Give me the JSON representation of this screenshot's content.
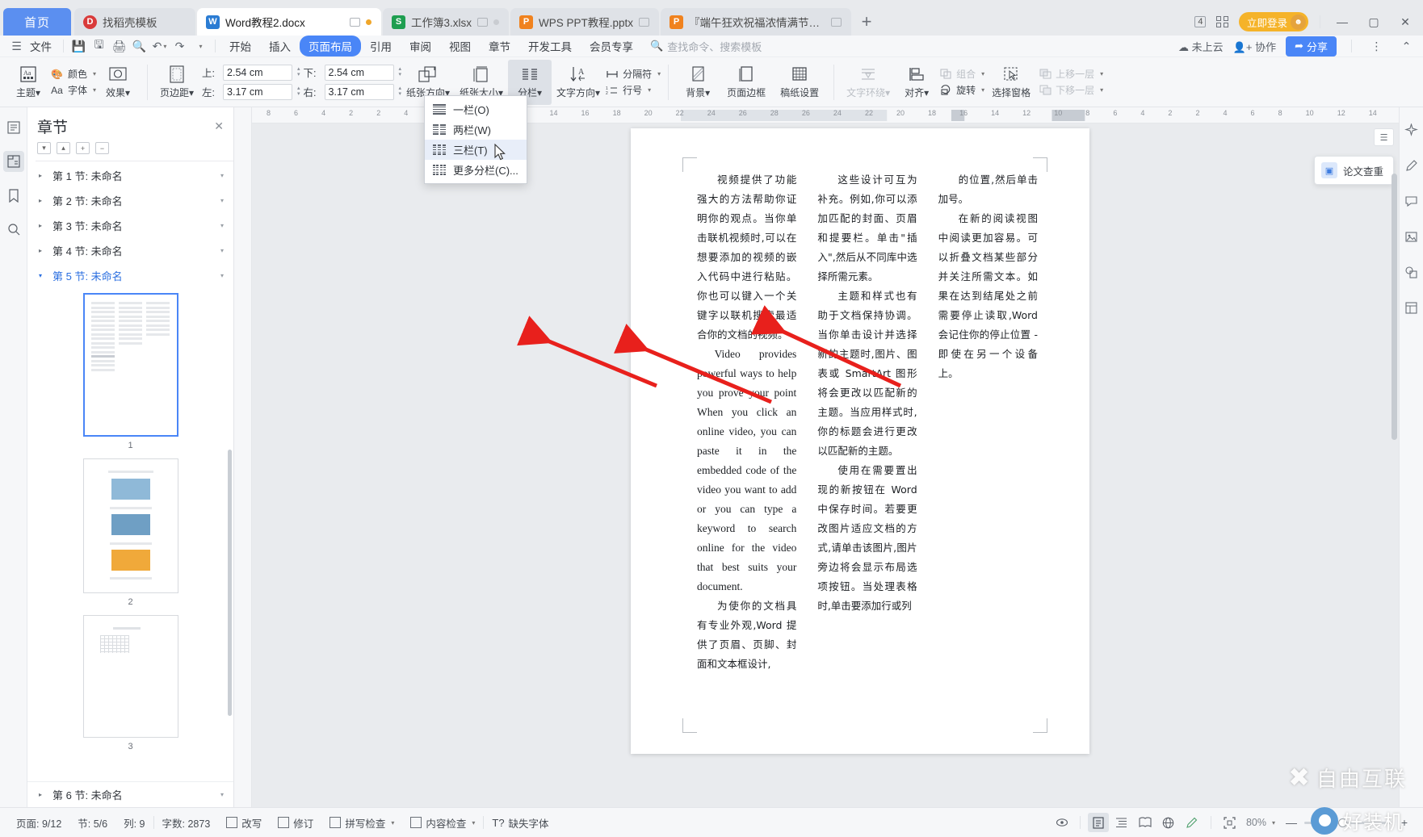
{
  "window": {
    "tabs": [
      {
        "label": "首页",
        "icon": "home-tab",
        "type": "home"
      },
      {
        "label": "找稻壳模板",
        "icon": "docer-icon",
        "type": "docer"
      },
      {
        "label": "Word教程2.docx",
        "icon": "word-icon",
        "type": "word",
        "active": true,
        "modified": true
      },
      {
        "label": "工作簿3.xlsx",
        "icon": "excel-icon",
        "type": "excel"
      },
      {
        "label": "WPS PPT教程.pptx",
        "icon": "ppt-icon",
        "type": "ppt"
      },
      {
        "label": "『端午狂欢祝福浓情满节日』",
        "icon": "ppt-icon",
        "type": "ppt"
      }
    ],
    "new_tab_label": "+",
    "tab_count_badge": "4",
    "login_label": "立即登录",
    "minimize": "—",
    "maximize": "▢",
    "close": "✕"
  },
  "menubar": {
    "file_label": "文件",
    "quick_icons": [
      "save-icon",
      "save-as-icon",
      "print-icon",
      "print-preview-icon",
      "undo-icon",
      "redo-icon",
      "customize-icon"
    ],
    "items": [
      {
        "label": "开始"
      },
      {
        "label": "插入"
      },
      {
        "label": "页面布局",
        "selected": true
      },
      {
        "label": "引用"
      },
      {
        "label": "审阅"
      },
      {
        "label": "视图"
      },
      {
        "label": "章节"
      },
      {
        "label": "开发工具"
      },
      {
        "label": "会员专享"
      }
    ],
    "search_placeholder": "查找命令、搜索模板",
    "cloud_status": "未上云",
    "collab_label": "协作",
    "share_label": "分享"
  },
  "ribbon": {
    "theme_label": "主题",
    "color_label": "颜色",
    "font_label": "字体",
    "effect_label": "效果",
    "margin_label": "页边距",
    "margins": [
      {
        "label": "上:",
        "value": "2.54 cm"
      },
      {
        "label": "下:",
        "value": "2.54 cm"
      },
      {
        "label": "左:",
        "value": "3.17 cm"
      },
      {
        "label": "右:",
        "value": "3.17 cm"
      }
    ],
    "paper_orientation": "纸张方向",
    "paper_size": "纸张大小",
    "columns_label": "分栏",
    "text_direction": "文字方向",
    "separator_label": "分隔符",
    "line_number_label": "行号",
    "background_label": "背景",
    "page_border_label": "页面边框",
    "grid_setup_label": "稿纸设置",
    "text_wrap_label": "文字环绕",
    "align_label": "对齐",
    "group_label": "组合",
    "rotate_label": "旋转",
    "select_pane_label": "选择窗格",
    "bring_forward": "上移一层",
    "send_backward": "下移一层"
  },
  "columns_menu": {
    "items": [
      {
        "label": "一栏(O)",
        "cols": 1
      },
      {
        "label": "两栏(W)",
        "cols": 2
      },
      {
        "label": "三栏(T)",
        "cols": 3,
        "highlighted": true
      },
      {
        "label": "更多分栏(C)...",
        "cols": 4
      }
    ]
  },
  "navpane": {
    "title": "章节",
    "close_label": "✕",
    "tools": [
      "collapse-down",
      "collapse-up",
      "expand-all",
      "collapse-all"
    ],
    "sections": [
      {
        "label": "第 1 节: 未命名",
        "expanded": false
      },
      {
        "label": "第 2 节: 未命名",
        "expanded": false
      },
      {
        "label": "第 3 节: 未命名",
        "expanded": false
      },
      {
        "label": "第 4 节: 未命名",
        "expanded": false
      },
      {
        "label": "第 5 节: 未命名",
        "expanded": true
      },
      {
        "label": "第 6 节: 未命名",
        "expanded": false
      }
    ],
    "thumb_labels": [
      "1",
      "2",
      "3"
    ]
  },
  "rail": {
    "icons": [
      "outline-icon",
      "chapters-icon",
      "bookmark-icon",
      "search-icon"
    ]
  },
  "right_rail": {
    "icons": [
      "ai-icon",
      "pen-icon",
      "comment-icon",
      "image-icon",
      "shapes-icon",
      "template-icon"
    ],
    "card_label": "论文查重"
  },
  "document": {
    "columns": [
      {
        "paragraphs": [
          {
            "text": "视频提供了功能强大的方法帮助你证明你的观点。当你单击联机视频时,可以在想要添加的视频的嵌入代码中进行粘贴。你也可以键入一个关键字以联机搜索最适合你的文档的视频。"
          },
          {
            "text": "Video provides powerful ways to help you prove your point When you click an online video, you can paste it in the embedded code of the video you want to add or you can type a keyword to search online for the video that best suits your document.",
            "lang": "en"
          },
          {
            "text": "为使你的文档具有专业外观,Word 提供了页眉、页脚、封面和文本框设计,"
          }
        ]
      },
      {
        "paragraphs": [
          {
            "text": "这些设计可互为补充。例如,你可以添加匹配的封面、页眉和提要栏。单击\"插入\",然后从不同库中选择所需元素。"
          },
          {
            "text": "主题和样式也有助于文档保持协调。当你单击设计并选择新的主题时,图片、图表或 SmartArt 图形将会更改以匹配新的主题。当应用样式时,你的标题会进行更改以匹配新的主题。"
          },
          {
            "text": "使用在需要置出现的新按钮在 Word 中保存时间。若要更改图片适应文档的方式,请单击该图片,图片旁边将会显示布局选项按钮。当处理表格时,单击要添加行或列"
          }
        ]
      },
      {
        "paragraphs": [
          {
            "text": "的位置,然后单击加号。"
          },
          {
            "text": "在新的阅读视图中阅读更加容易。可以折叠文档某些部分并关注所需文本。如果在达到结尾处之前需要停止读取,Word 会记住你的停止位置 - 即使在另一个设备上。"
          }
        ]
      }
    ]
  },
  "statusbar": {
    "page_label": "页面: 9/12",
    "section_label": "节: 5/6",
    "column_label": "列: 9",
    "word_count_label": "字数: 2873",
    "overwrite_label": "改写",
    "revision_label": "修订",
    "spellcheck_label": "拼写检查",
    "content_check_label": "内容检查",
    "missing_font_label": "缺失字体",
    "zoom_label": "80%",
    "view_icons": [
      "focus-icon",
      "page-view-icon",
      "outline-view-icon",
      "reading-view-icon",
      "web-view-icon",
      "edit-icon"
    ],
    "zoom_out": "—",
    "zoom_in": "+"
  },
  "watermarks": {
    "wm1": "自由互联",
    "wm2": "好装机"
  },
  "colors": {
    "accent": "#4a86f7",
    "home_tab": "#5b8ff0",
    "login": "#f5b329",
    "annotation_red": "#e8201c"
  }
}
